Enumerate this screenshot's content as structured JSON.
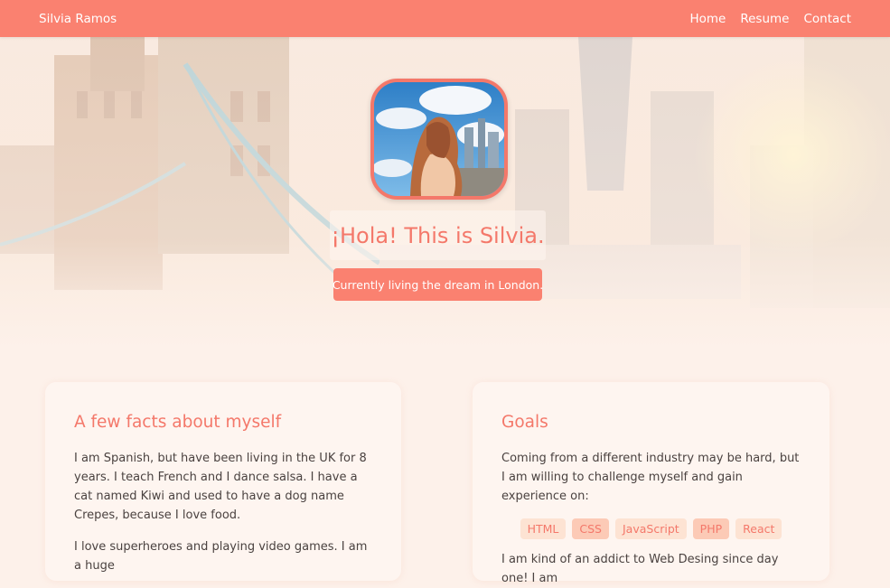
{
  "navbar": {
    "brand": "Silvia Ramos",
    "links": [
      {
        "label": "Home"
      },
      {
        "label": "Resume"
      },
      {
        "label": "Contact"
      }
    ],
    "color": "#fa8170"
  },
  "hero": {
    "avatar_icon": "profile-photo",
    "title": "¡Hola! This is Silvia.",
    "subtitle": "Currently living the dream in London."
  },
  "facts": {
    "heading": "A few facts about myself",
    "paragraphs": [
      "I am Spanish, but have been living in the UK for 8 years. I teach French and I dance salsa. I have a cat named Kiwi and used to have a dog name Crepes, because I love food.",
      "I love superheroes and playing video games. I am a huge"
    ]
  },
  "goals": {
    "heading": "Goals",
    "intro": "Coming from a different industry may be hard, but I am willing to challenge myself and gain experience on:",
    "skills": [
      "HTML",
      "CSS",
      "JavaScript",
      "PHP",
      "React"
    ],
    "outro": "I am kind of an addict to Web Desing since day one! I am"
  },
  "colors": {
    "accent": "#f4786a",
    "background": "#fdf1ea",
    "skill_bg": "#fde3d3",
    "skill_bg_alt": "#fccab6"
  }
}
